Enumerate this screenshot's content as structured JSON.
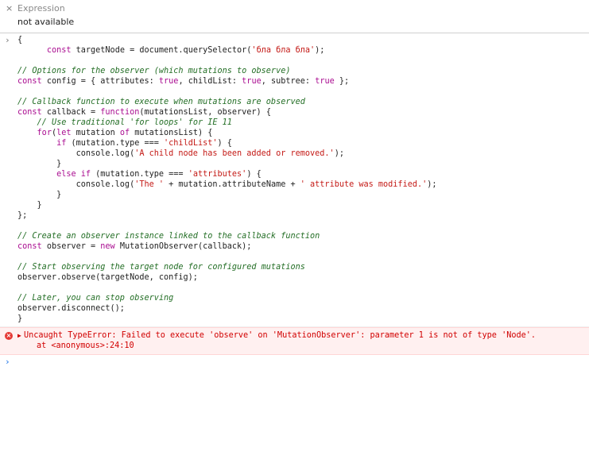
{
  "expression": {
    "close_icon": "×",
    "title": "Expression",
    "value": "not available"
  },
  "console": {
    "input_prompt": "›",
    "code_lines": [
      [
        [
          "p",
          "{"
        ]
      ],
      [
        [
          "p",
          "      "
        ],
        [
          "k",
          "const "
        ],
        [
          "p",
          "targetNode = document.querySelector("
        ],
        [
          "s",
          "'бла бла бла'"
        ],
        [
          "p",
          ");"
        ]
      ],
      [
        [
          "p",
          " "
        ]
      ],
      [
        [
          "c",
          "// Options for the observer (which mutations to observe)"
        ]
      ],
      [
        [
          "k",
          "const "
        ],
        [
          "p",
          "config = { attributes: "
        ],
        [
          "k",
          "true"
        ],
        [
          "p",
          ", childList: "
        ],
        [
          "k",
          "true"
        ],
        [
          "p",
          ", subtree: "
        ],
        [
          "k",
          "true"
        ],
        [
          "p",
          " };"
        ]
      ],
      [
        [
          "p",
          " "
        ]
      ],
      [
        [
          "c",
          "// Callback function to execute when mutations are observed"
        ]
      ],
      [
        [
          "k",
          "const "
        ],
        [
          "p",
          "callback = "
        ],
        [
          "k",
          "function"
        ],
        [
          "p",
          "(mutationsList, observer) {"
        ]
      ],
      [
        [
          "p",
          "    "
        ],
        [
          "c",
          "// Use traditional 'for loops' for IE 11"
        ]
      ],
      [
        [
          "p",
          "    "
        ],
        [
          "k",
          "for"
        ],
        [
          "p",
          "("
        ],
        [
          "k",
          "let "
        ],
        [
          "p",
          "mutation "
        ],
        [
          "k",
          "of "
        ],
        [
          "p",
          "mutationsList) {"
        ]
      ],
      [
        [
          "p",
          "        "
        ],
        [
          "k",
          "if "
        ],
        [
          "p",
          "(mutation.type === "
        ],
        [
          "s",
          "'childList'"
        ],
        [
          "p",
          ") {"
        ]
      ],
      [
        [
          "p",
          "            console.log("
        ],
        [
          "s",
          "'A child node has been added or removed.'"
        ],
        [
          "p",
          ");"
        ]
      ],
      [
        [
          "p",
          "        }"
        ]
      ],
      [
        [
          "p",
          "        "
        ],
        [
          "k",
          "else if "
        ],
        [
          "p",
          "(mutation.type === "
        ],
        [
          "s",
          "'attributes'"
        ],
        [
          "p",
          ") {"
        ]
      ],
      [
        [
          "p",
          "            console.log("
        ],
        [
          "s",
          "'The '"
        ],
        [
          "p",
          " + mutation.attributeName + "
        ],
        [
          "s",
          "' attribute was modified.'"
        ],
        [
          "p",
          ");"
        ]
      ],
      [
        [
          "p",
          "        }"
        ]
      ],
      [
        [
          "p",
          "    }"
        ]
      ],
      [
        [
          "p",
          "};"
        ]
      ],
      [
        [
          "p",
          " "
        ]
      ],
      [
        [
          "c",
          "// Create an observer instance linked to the callback function"
        ]
      ],
      [
        [
          "k",
          "const "
        ],
        [
          "p",
          "observer = "
        ],
        [
          "k",
          "new "
        ],
        [
          "p",
          "MutationObserver(callback);"
        ]
      ],
      [
        [
          "p",
          " "
        ]
      ],
      [
        [
          "c",
          "// Start observing the target node for configured mutations"
        ]
      ],
      [
        [
          "p",
          "observer.observe(targetNode, config);"
        ]
      ],
      [
        [
          "p",
          " "
        ]
      ],
      [
        [
          "c",
          "// Later, you can stop observing"
        ]
      ],
      [
        [
          "p",
          "observer.disconnect();"
        ]
      ],
      [
        [
          "p",
          "}"
        ]
      ]
    ],
    "error": {
      "icon": "×",
      "expand_icon": "▶",
      "message": "Uncaught TypeError: Failed to execute 'observe' on 'MutationObserver': parameter 1 is not of type 'Node'.",
      "location_prefix": "at ",
      "location": "<anonymous>:24:10"
    },
    "new_prompt": "›"
  },
  "colors": {
    "keyword": "#aa0d91",
    "string": "#c41a16",
    "comment": "#236e25",
    "error_text": "#d10000",
    "error_bg": "#fff0f0",
    "prompt_blue": "#1a73e8"
  }
}
